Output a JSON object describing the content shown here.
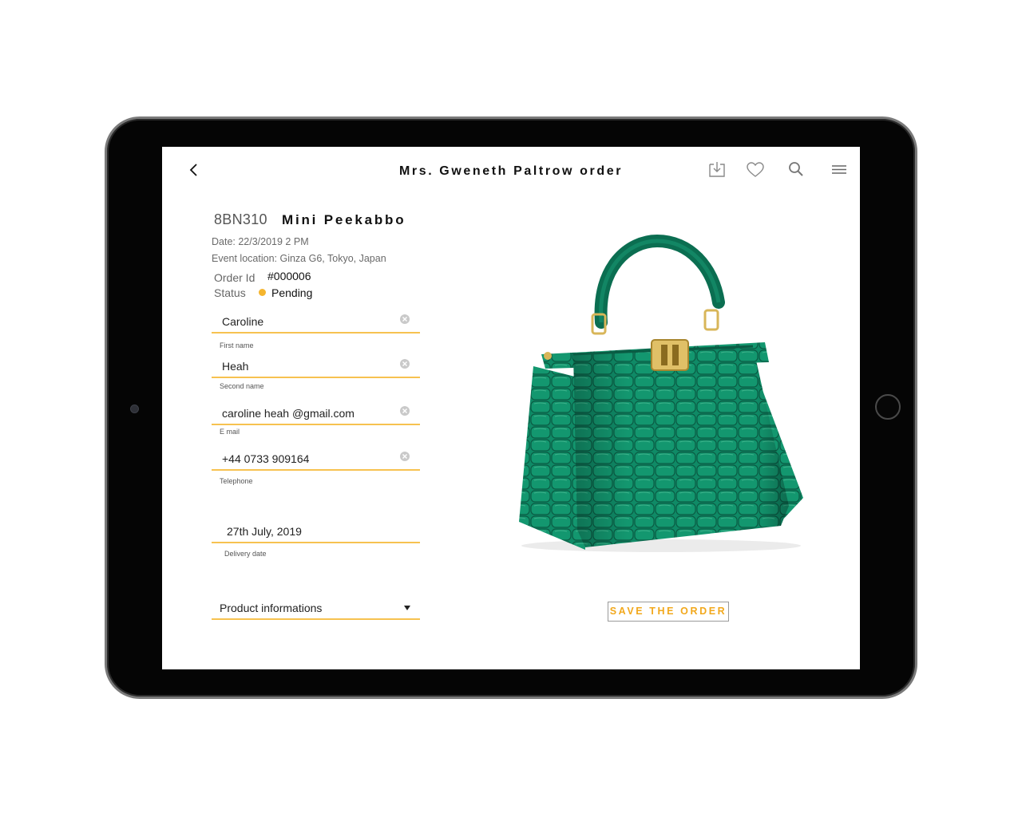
{
  "header": {
    "title": "Mrs. Gweneth Paltrow order",
    "back_icon": "chevron-left-icon",
    "actions": [
      "download-icon",
      "heart-icon",
      "search-icon",
      "menu-icon"
    ]
  },
  "product": {
    "code": "8BN310",
    "name": "Mini Peekabbo",
    "image": "green-crocodile-handbag"
  },
  "meta": {
    "date": "Date: 22/3/2019 2 PM",
    "location": "Event location: Ginza G6, Tokyo, Japan"
  },
  "order": {
    "id_label": "Order Id",
    "id_value": "#000006",
    "status_label": "Status",
    "status_value": "Pending",
    "status_color": "#f5b52e"
  },
  "form": {
    "first_name": {
      "value": "Caroline",
      "label": "First name"
    },
    "second_name": {
      "value": "Heah",
      "label": "Second name"
    },
    "email": {
      "value": "caroline heah @gmail.com",
      "label": "E mail"
    },
    "telephone": {
      "value": "+44  0733 909164",
      "label": "Telephone"
    },
    "delivery": {
      "value": "27th July, 2019",
      "label": "Delivery date"
    },
    "product_info": {
      "value": "Product informations"
    }
  },
  "actions": {
    "save_label": "SAVE THE ORDER"
  },
  "colors": {
    "accent": "#f7c250",
    "accent_text": "#f2a81c",
    "bag_green": "#0f8a66"
  }
}
